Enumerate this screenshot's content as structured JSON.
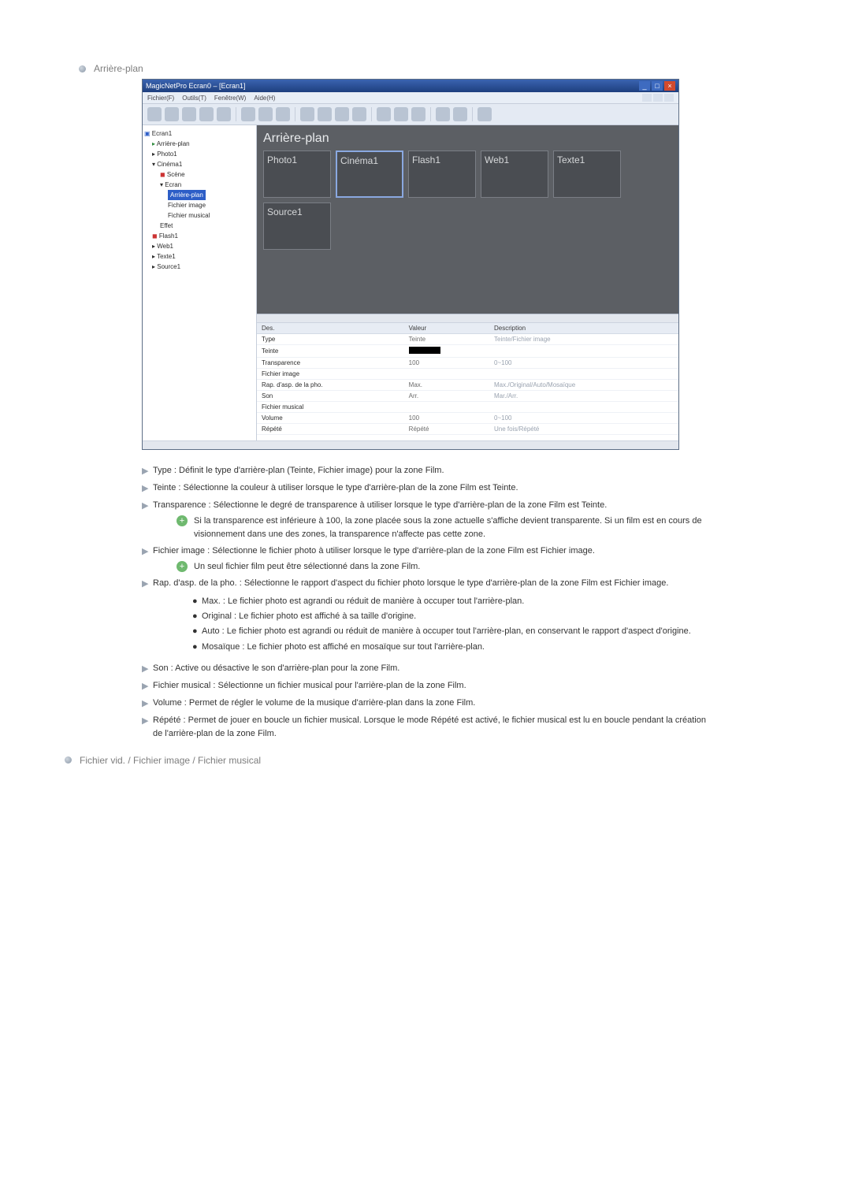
{
  "section1": {
    "title": "Arrière-plan"
  },
  "section2": {
    "title": "Fichier vid. / Fichier image / Fichier musical"
  },
  "app": {
    "title": "MagicNetPro Ecran0 – [Ecran1]",
    "menus": [
      "Fichier(F)",
      "Outils(T)",
      "Fenêtre(W)",
      "Aide(H)"
    ]
  },
  "tree": {
    "root": "Ecran1",
    "items": [
      "Arrière-plan",
      "Photo1",
      "Cinéma1",
      "Scène",
      "Ecran",
      "Arrière-plan",
      "Fichier image",
      "Fichier musical",
      "Effet",
      "Flash1",
      "Web1",
      "Texte1",
      "Source1"
    ]
  },
  "canvas": {
    "title": "Arrière-plan",
    "thumbs": [
      "Photo1",
      "Cinéma1",
      "Flash1",
      "Web1",
      "Texte1",
      "Source1"
    ]
  },
  "props": {
    "headers": [
      "Des.",
      "Valeur",
      "Description"
    ],
    "rows": [
      {
        "k": "Type",
        "v": "Teinte",
        "d": "Teinte/Fichier image"
      },
      {
        "k": "Teinte",
        "v": "",
        "d": ""
      },
      {
        "k": "Transparence",
        "v": "100",
        "d": "0~100"
      },
      {
        "k": "Fichier image",
        "v": "",
        "d": ""
      },
      {
        "k": "Rap. d'asp. de la pho.",
        "v": "Max.",
        "d": "Max./Original/Auto/Mosaïque"
      },
      {
        "k": "Son",
        "v": "Arr.",
        "d": "Mar./Arr."
      },
      {
        "k": "Fichier musical",
        "v": "",
        "d": ""
      },
      {
        "k": "Volume",
        "v": "100",
        "d": "0~100"
      },
      {
        "k": "Répété",
        "v": "Répété",
        "d": "Une fois/Répété"
      }
    ]
  },
  "defs": {
    "type": "Type : Définit le type d'arrière-plan (Teinte, Fichier image) pour la zone Film.",
    "teinte": "Teinte : Sélectionne la couleur à utiliser lorsque le type d'arrière-plan de la zone Film est Teinte.",
    "trans": "Transparence : Sélectionne le degré de transparence à utiliser lorsque le type d'arrière-plan de la zone Film est Teinte.",
    "trans_note": "Si la transparence est inférieure à 100, la zone placée sous la zone actuelle s'affiche devient transparente. Si un film est en cours de visionnement dans une des zones, la transparence n'affecte pas cette zone.",
    "fimg": "Fichier image : Sélectionne le fichier photo à utiliser lorsque le type d'arrière-plan de la zone Film est Fichier image.",
    "fimg_note": "Un seul fichier film peut être sélectionné dans la zone Film.",
    "rap": "Rap. d'asp. de la pho. : Sélectionne le rapport d'aspect du fichier photo lorsque le type d'arrière-plan de la zone Film est Fichier image.",
    "rap_max": "Max. : Le fichier photo est agrandi ou réduit de manière à occuper tout l'arrière-plan.",
    "rap_orig": "Original : Le fichier photo est affiché à sa taille d'origine.",
    "rap_auto": "Auto : Le fichier photo est agrandi ou réduit de manière à occuper tout l'arrière-plan, en conservant le rapport d'aspect d'origine.",
    "rap_mos": "Mosaïque : Le fichier photo est affiché en mosaïque sur tout l'arrière-plan.",
    "son": "Son : Active ou désactive le son d'arrière-plan pour la zone Film.",
    "fmus": "Fichier musical : Sélectionne un fichier musical pour l'arrière-plan de la zone Film.",
    "vol": "Volume : Permet de régler le volume de la musique d'arrière-plan dans la zone Film.",
    "rep": "Répété : Permet de jouer en boucle un fichier musical. Lorsque le mode Répété est activé, le fichier musical est lu en boucle pendant la création de l'arrière-plan de la zone Film."
  }
}
